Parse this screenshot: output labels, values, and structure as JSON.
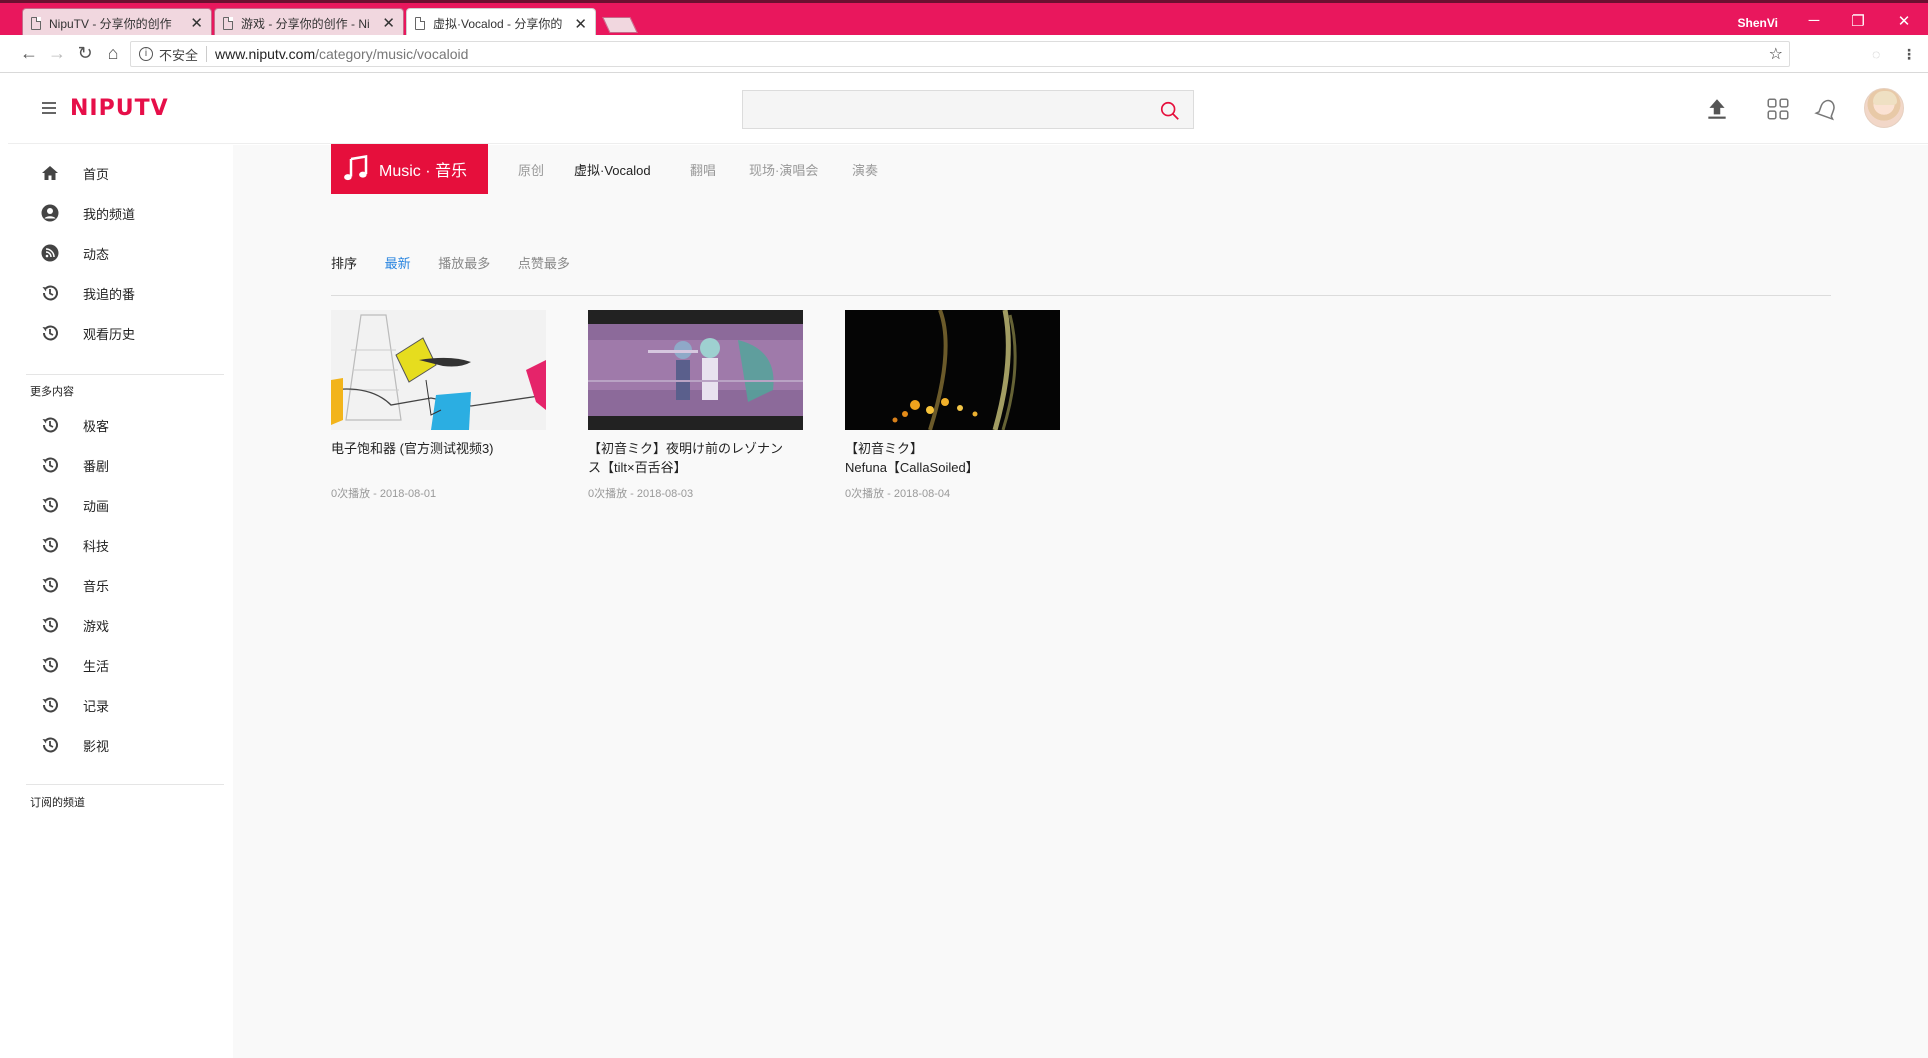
{
  "browser": {
    "tabs": [
      {
        "title": "NipuTV - 分享你的创作",
        "close": "✕"
      },
      {
        "title": "游戏 - 分享你的创作 - Ni",
        "close": "✕"
      },
      {
        "title": "虚拟·Vocalod - 分享你的",
        "close": "✕"
      }
    ],
    "user": "ShenVi",
    "controls": {
      "minimize": "─",
      "restore": "❐",
      "close": "✕"
    },
    "nav": {
      "back": "←",
      "forward": "→",
      "reload": "↻",
      "home": "⌂"
    },
    "security_text": "不安全",
    "url_host": "www.niputv.com",
    "url_path": "/category/music/vocaloid",
    "star": "☆"
  },
  "header": {
    "logo": "NIPUTV",
    "search": {
      "placeholder": "",
      "value": ""
    },
    "icons": [
      "upload-icon",
      "apps-grid-icon",
      "bell-icon",
      "user-avatar"
    ]
  },
  "sidebar": {
    "main_items": [
      {
        "label": "首页",
        "icon": "home-icon"
      },
      {
        "label": "我的频道",
        "icon": "user-circle-icon"
      },
      {
        "label": "动态",
        "icon": "rss-icon"
      },
      {
        "label": "我追的番",
        "icon": "history-icon"
      },
      {
        "label": "观看历史",
        "icon": "history-icon"
      }
    ],
    "more_heading": "更多内容",
    "more_items": [
      {
        "label": "极客"
      },
      {
        "label": "番剧"
      },
      {
        "label": "动画"
      },
      {
        "label": "科技"
      },
      {
        "label": "音乐"
      },
      {
        "label": "游戏"
      },
      {
        "label": "生活"
      },
      {
        "label": "记录"
      },
      {
        "label": "影视"
      }
    ],
    "subscribed_heading": "订阅的频道"
  },
  "main": {
    "category": "Music · 音乐",
    "subcategories": [
      {
        "label": "原创",
        "active": false
      },
      {
        "label": "虚拟·Vocalod",
        "active": true
      },
      {
        "label": "翻唱",
        "active": false
      },
      {
        "label": "现场·演唱会",
        "active": false
      },
      {
        "label": "演奏",
        "active": false
      }
    ],
    "sort_label": "排序",
    "sort_options": [
      {
        "label": "最新",
        "active": true
      },
      {
        "label": "播放最多",
        "active": false
      },
      {
        "label": "点赞最多",
        "active": false
      }
    ],
    "videos": [
      {
        "title_line1": "电子饱和器 (官方测试视频3)",
        "title_line2": "",
        "meta": "0次播放 - 2018-08-01"
      },
      {
        "title_line1": "【初音ミク】夜明け前のレゾナン",
        "title_line2": "ス【tilt×百舌谷】",
        "meta": "0次播放 - 2018-08-03"
      },
      {
        "title_line1": "【初音ミク】",
        "title_line2": "Nefuna【CallaSoiled】",
        "meta": "0次播放 - 2018-08-04"
      }
    ]
  },
  "colors": {
    "brand": "#e60f3c",
    "tabbar": "#e9175d",
    "sort_active": "#2b86e0"
  }
}
